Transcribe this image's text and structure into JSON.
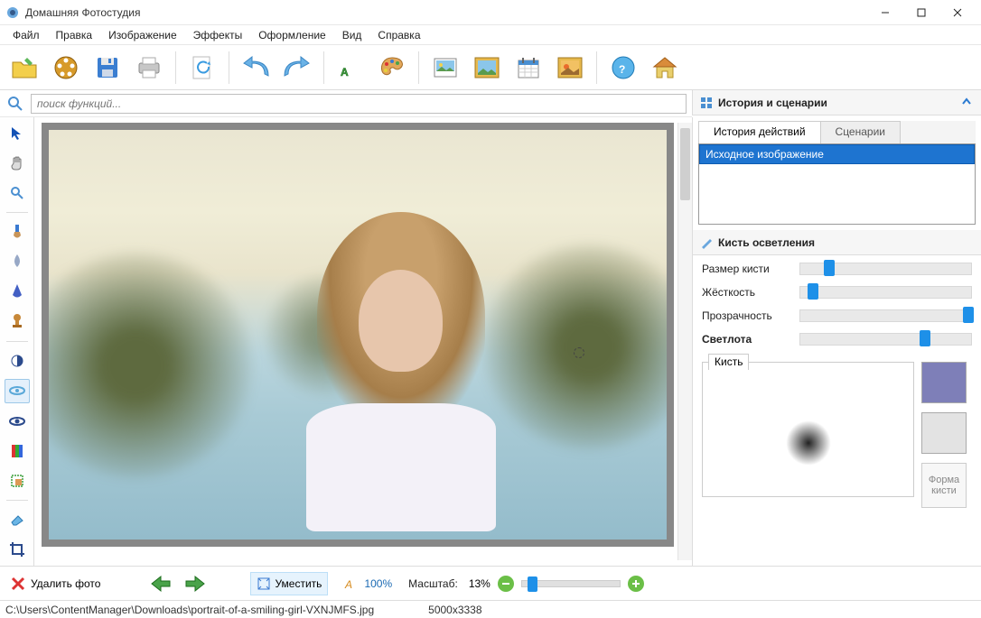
{
  "app": {
    "title": "Домашняя Фотостудия"
  },
  "menu": [
    "Файл",
    "Правка",
    "Изображение",
    "Эффекты",
    "Оформление",
    "Вид",
    "Справка"
  ],
  "search": {
    "placeholder": "поиск функций..."
  },
  "right": {
    "history_title": "История и сценарии",
    "tabs": [
      "История действий",
      "Сценарии"
    ],
    "history_item": "Исходное изображение",
    "brush_title": "Кисть осветления",
    "sliders": {
      "size": {
        "label": "Размер кисти",
        "pos": 14
      },
      "hardness": {
        "label": "Жёсткость",
        "pos": 4
      },
      "opacity": {
        "label": "Прозрачность",
        "pos": 95
      },
      "lightness": {
        "label": "Светлота",
        "pos": 70
      }
    },
    "brush_tab": "Кисть",
    "shape_btn": "Форма кисти",
    "swatch_color": "#7e7fb8"
  },
  "bottom": {
    "delete": "Удалить фото",
    "fit": "Уместить",
    "zoom100": "100%",
    "scale_label": "Масштаб:",
    "scale_value": "13%"
  },
  "status": {
    "path": "C:\\Users\\ContentManager\\Downloads\\portrait-of-a-smiling-girl-VXNJMFS.jpg",
    "dimensions": "5000x3338"
  }
}
